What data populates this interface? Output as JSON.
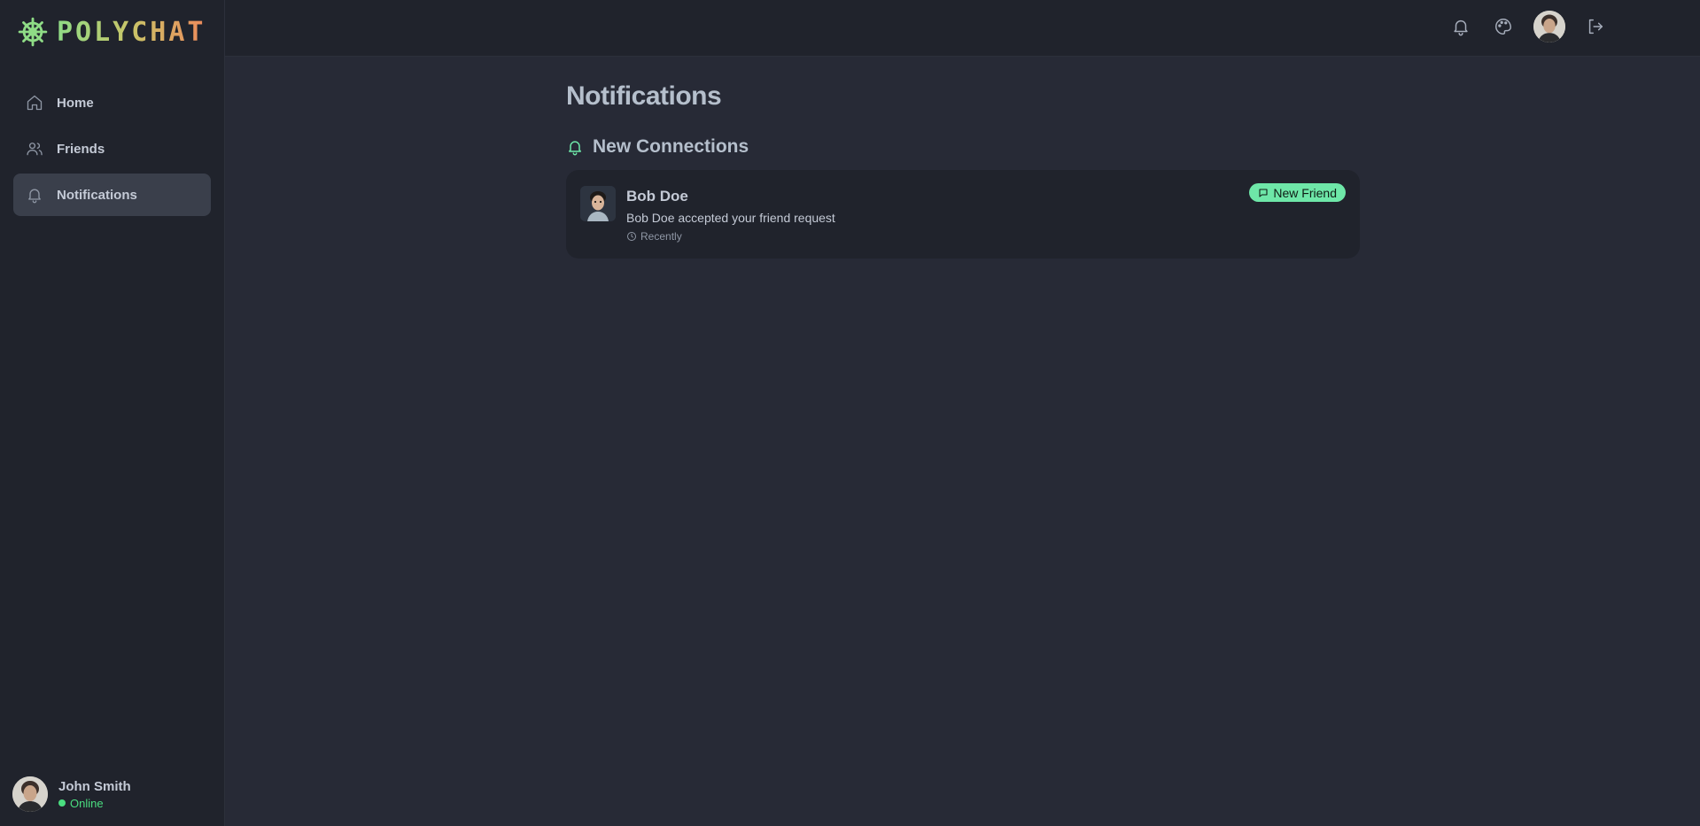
{
  "app": {
    "name": "POLYCHAT"
  },
  "sidebar": {
    "items": [
      {
        "label": "Home",
        "icon": "home-icon"
      },
      {
        "label": "Friends",
        "icon": "users-icon"
      },
      {
        "label": "Notifications",
        "icon": "bell-icon",
        "active": true
      }
    ],
    "user": {
      "name": "John Smith",
      "status": "Online"
    }
  },
  "header": {
    "icons": [
      "bell-icon",
      "palette-icon",
      "avatar",
      "logout-icon"
    ]
  },
  "main": {
    "title": "Notifications",
    "section_title": "New Connections",
    "notifications": [
      {
        "name": "Bob Doe",
        "message": "Bob Doe accepted your friend request",
        "time": "Recently",
        "badge": "New Friend"
      }
    ]
  },
  "colors": {
    "background": "#272a36",
    "sidebar": "#20232c",
    "accent_green": "#4ade80",
    "badge": "#6ee7a8"
  }
}
